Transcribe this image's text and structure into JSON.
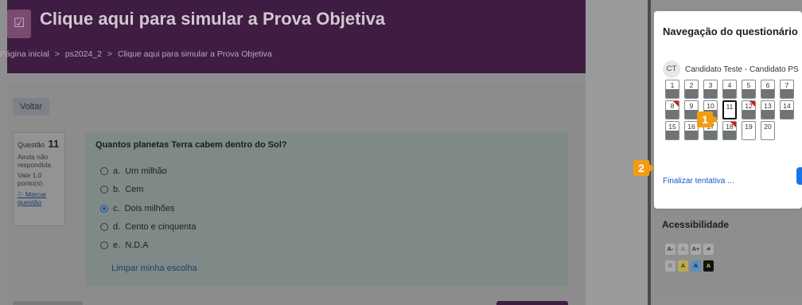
{
  "header": {
    "title": "Clique aqui para simular a Prova Objetiva",
    "icon": "edit-check-icon",
    "breadcrumb": [
      "Página inicial",
      ">",
      "ps2024_2",
      ">",
      "Clique aqui para simular a Prova Objetiva"
    ]
  },
  "actions": {
    "back_label": "Voltar"
  },
  "question_info": {
    "label": "Questão",
    "number": "11",
    "status_line1": "Ainda não",
    "status_line2": "respondida",
    "points_line1": "Vale 1,0",
    "points_line2": "ponto(s).",
    "flag_line1": "Marcar",
    "flag_line2": "questão"
  },
  "question": {
    "text": "Quantos planetas Terra cabem dentro do Sol?",
    "options": [
      {
        "letter": "a.",
        "text": "Um milhão",
        "selected": false
      },
      {
        "letter": "b.",
        "text": "Cem",
        "selected": false
      },
      {
        "letter": "c.",
        "text": "Dois milhões",
        "selected": true
      },
      {
        "letter": "d.",
        "text": "Cento e cinquenta",
        "selected": false
      },
      {
        "letter": "e.",
        "text": "N.D.A",
        "selected": false
      }
    ],
    "clear_label": "Limpar minha escolha"
  },
  "quiz_nav": {
    "title": "Navegação do questionário",
    "avatar_initials": "CT",
    "user_name": "Candidato Teste - Candidato PS",
    "questions": [
      {
        "n": "1",
        "state": "answered",
        "flagged": false
      },
      {
        "n": "2",
        "state": "answered",
        "flagged": false
      },
      {
        "n": "3",
        "state": "answered",
        "flagged": false
      },
      {
        "n": "4",
        "state": "answered",
        "flagged": false
      },
      {
        "n": "5",
        "state": "answered",
        "flagged": false
      },
      {
        "n": "6",
        "state": "answered",
        "flagged": false
      },
      {
        "n": "7",
        "state": "answered",
        "flagged": false
      },
      {
        "n": "8",
        "state": "answered",
        "flagged": true
      },
      {
        "n": "9",
        "state": "answered",
        "flagged": false
      },
      {
        "n": "10",
        "state": "answered",
        "flagged": false
      },
      {
        "n": "11",
        "state": "current",
        "flagged": false
      },
      {
        "n": "12",
        "state": "answered",
        "flagged": true
      },
      {
        "n": "13",
        "state": "answered",
        "flagged": false
      },
      {
        "n": "14",
        "state": "answered",
        "flagged": false
      },
      {
        "n": "15",
        "state": "answered",
        "flagged": false
      },
      {
        "n": "16",
        "state": "answered",
        "flagged": false
      },
      {
        "n": "17",
        "state": "answered",
        "flagged": false
      },
      {
        "n": "18",
        "state": "answered",
        "flagged": true
      },
      {
        "n": "19",
        "state": "blank",
        "flagged": false
      },
      {
        "n": "20",
        "state": "blank",
        "flagged": false
      }
    ],
    "finish_label": "Finalizar tentativa ..."
  },
  "callouts": {
    "one": "1",
    "two": "2"
  },
  "accessibility": {
    "title": "Acessibilidade",
    "font_buttons": [
      "A-",
      "A",
      "A+"
    ],
    "contrast_buttons": [
      "R",
      "A",
      "A",
      "A"
    ]
  },
  "colors": {
    "header_purple": "#3f1d42",
    "callout_orange": "#f39c12",
    "flag_red": "#d11a1a",
    "link_blue": "#1a56c4"
  }
}
